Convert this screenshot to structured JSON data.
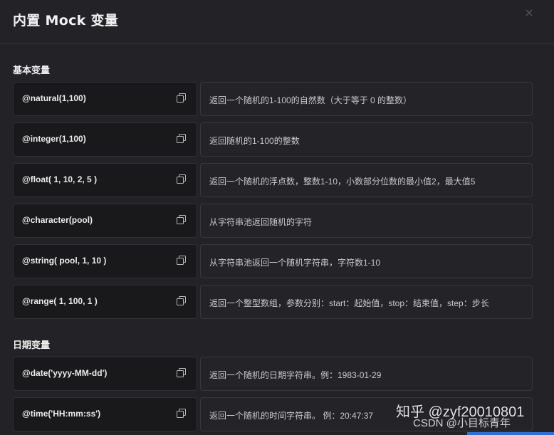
{
  "dialog": {
    "title": "内置 Mock 变量",
    "close_icon": "×"
  },
  "sections": {
    "basic": {
      "title": "基本变量"
    },
    "date": {
      "title": "日期变量"
    }
  },
  "rows": [
    {
      "variable": "@natural(1,100)",
      "description": "返回一个随机的1-100的自然数（大于等于 0 的整数）"
    },
    {
      "variable": "@integer(1,100)",
      "description": "返回随机的1-100的整数"
    },
    {
      "variable": "@float( 1, 10, 2, 5 )",
      "description": "返回一个随机的浮点数，整数1-10，小数部分位数的最小值2，最大值5"
    },
    {
      "variable": "@character(pool)",
      "description": "从字符串池返回随机的字符"
    },
    {
      "variable": "@string( pool, 1, 10 )",
      "description": "从字符串池返回一个随机字符串，字符数1-10"
    },
    {
      "variable": "@range( 1, 100, 1 )",
      "description": "返回一个整型数组，参数分别：start：起始值，stop：结束值，step：步长"
    },
    {
      "variable": "@date('yyyy-MM-dd')",
      "description": "返回一个随机的日期字符串。例：1983-01-29"
    },
    {
      "variable": "@time('HH:mm:ss')",
      "description": "返回一个随机的时间字符串。 例：20:47:37"
    }
  ],
  "watermark": {
    "line1": "知乎 @zyf20010801",
    "line2": "CSDN @小目标青年"
  },
  "colors": {
    "background": "#232327",
    "variable_cell": "#19191c",
    "description_cell": "#242428",
    "accent": "#2f6fd6"
  }
}
